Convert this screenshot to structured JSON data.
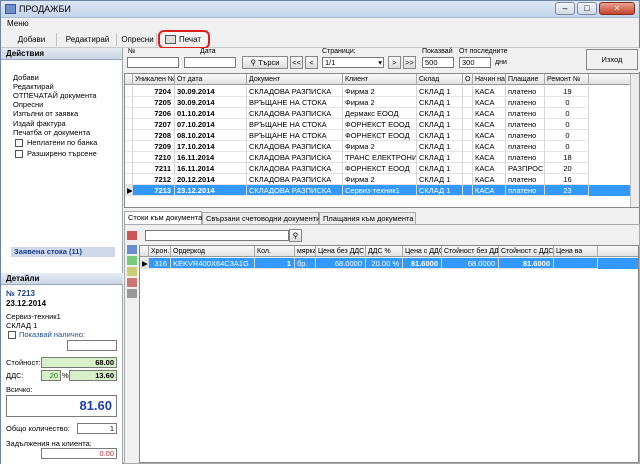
{
  "window": {
    "title": "ПРОДАЖБИ",
    "min": "–",
    "max": "□",
    "close": "×"
  },
  "menu": {
    "label": "Меню"
  },
  "toolbar": {
    "add": "Добави",
    "edit": "Редактирай",
    "refresh": "Опресни",
    "print": "Печат"
  },
  "actions": {
    "header": "Действия",
    "items": [
      "Добави",
      "Редактирай",
      "ОТПЕЧАТАЙ документа",
      "Опресни",
      "Изпълни от заявка",
      "Издай фактура",
      "Печатба от документа"
    ],
    "checks": [
      "Неплатени по банка",
      "Разширено търсене"
    ],
    "selected": "Заявена стока (11)"
  },
  "details": {
    "header": "Детайли",
    "number": "№ 7213",
    "date": "23.12.2014",
    "client": "Сервиз-техник1",
    "warehouse": "СКЛАД 1",
    "show_available": "Показвай налично:",
    "value_label": "Стойност:",
    "value": "68.00",
    "vat_label": "ДДС:",
    "vat_pct": "20",
    "pct_sign": "%",
    "vat_value": "13.60",
    "total_label": "Всичко:",
    "total": "81.60",
    "qty_label": "Общо количество:",
    "qty": "1",
    "debt_label": "Задължения на клиента:",
    "debt": "0.00"
  },
  "filter": {
    "no_label": "№",
    "date_label": "Дата",
    "search_btn": "Търси",
    "pages_label": "Страници:",
    "page_value": "1/1",
    "show_label": "Показвай",
    "show_value": "500",
    "since_label": "От последните",
    "since_value": "300",
    "days": "дни",
    "exit": "Изход",
    "nav": [
      "<<",
      "<",
      ">",
      ">>"
    ]
  },
  "docs": {
    "columns": [
      "Уникален №",
      "От дата",
      "Документ",
      "Клиент",
      "Склад",
      "О",
      "Начин на",
      "Плащане",
      "Ремонт №"
    ],
    "rows": [
      [
        "7204",
        "30.09.2014",
        "СКЛАДОВА РАЗПИСКА",
        "Фирма 2",
        "СКЛАД 1",
        "",
        "КАСА",
        "платено",
        "19"
      ],
      [
        "7205",
        "30.09.2014",
        "ВРЪЩАНЕ НА СТОКА",
        "Фирма 2",
        "СКЛАД 1",
        "",
        "КАСА",
        "платено",
        "0"
      ],
      [
        "7206",
        "01.10.2014",
        "СКЛАДОВА РАЗПИСКА",
        "Дермакс ЕООД",
        "СКЛАД 1",
        "",
        "КАСА",
        "платено",
        "0"
      ],
      [
        "7207",
        "07.10.2014",
        "ВРЪЩАНЕ НА СТОКА",
        "ФОРНЕКСТ ЕООД",
        "СКЛАД 1",
        "",
        "КАСА",
        "платено",
        "0"
      ],
      [
        "7208",
        "08.10.2014",
        "ВРЪЩАНЕ НА СТОКА",
        "ФОРНЕКСТ ЕООД",
        "СКЛАД 1",
        "",
        "КАСА",
        "платено",
        "0"
      ],
      [
        "7209",
        "17.10.2014",
        "СКЛАДОВА РАЗПИСКА",
        "Фирма 2",
        "СКЛАД 1",
        "",
        "КАСА",
        "платено",
        "0"
      ],
      [
        "7210",
        "16.11.2014",
        "СКЛАДОВА РАЗПИСКА",
        "ТРАНС ЕЛЕКТРОНИК",
        "СКЛАД 1",
        "",
        "КАСА",
        "платено",
        "18"
      ],
      [
        "7211",
        "16.11.2014",
        "СКЛАДОВА РАЗПИСКА",
        "ФОРНЕКСТ ЕООД",
        "СКЛАД 1",
        "",
        "КАСА",
        "РАЗПРОСРЕЧ",
        "20"
      ],
      [
        "7212",
        "20.12.2014",
        "СКЛАДОВА РАЗПИСКА",
        "Фирма 2",
        "СКЛАД 1",
        "",
        "КАСА",
        "платено",
        "16"
      ],
      [
        "7213",
        "23.12.2014",
        "СКЛАДОВА РАЗПИСКА",
        "Сервиз-техник1",
        "СКЛАД 1",
        "",
        "КАСА",
        "платено",
        "23"
      ]
    ]
  },
  "tabs": [
    "Стоки към документа",
    "Свързани счетоводни документи",
    "Плащания към документа"
  ],
  "items": {
    "columns": [
      "Хрон. ID",
      "Ордеркод",
      "Кол.",
      "мярка",
      "Цена без ДДС",
      "ДДС %",
      "Цена с ДДС",
      "Стойност без ДДС",
      "Стойност с ДДС",
      "Цена ва"
    ],
    "rows": [
      [
        "316",
        "KEKVR400X64C3A1G",
        "1",
        "бр.",
        "68.0000",
        "20.00 %",
        "81.6000",
        "68.0000",
        "81.6000",
        ""
      ]
    ]
  }
}
